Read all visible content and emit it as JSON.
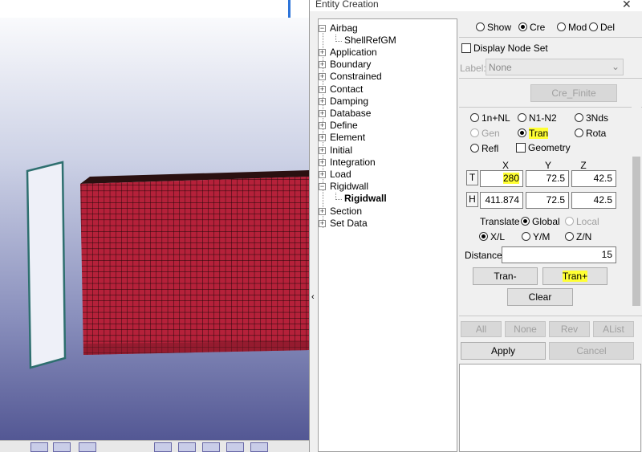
{
  "dialog": {
    "title": "Entity Creation",
    "close": "✕",
    "collapse_arrow": "‹"
  },
  "tree": {
    "items": [
      {
        "label": "Airbag",
        "expanded": true
      },
      {
        "label": "ShellRefGM",
        "child": true
      },
      {
        "label": "Application"
      },
      {
        "label": "Boundary"
      },
      {
        "label": "Constrained"
      },
      {
        "label": "Contact"
      },
      {
        "label": "Damping"
      },
      {
        "label": "Database"
      },
      {
        "label": "Define"
      },
      {
        "label": "Element"
      },
      {
        "label": "Initial"
      },
      {
        "label": "Integration"
      },
      {
        "label": "Load"
      },
      {
        "label": "Rigidwall",
        "expanded": true
      },
      {
        "label": "Rigidwall",
        "child": true,
        "bold": true
      },
      {
        "label": "Section"
      },
      {
        "label": "Set Data"
      }
    ]
  },
  "mode": {
    "show": "Show",
    "cre": "Cre",
    "mod": "Mod",
    "del": "Del",
    "selected": "Cre"
  },
  "display_node_set": "Display Node Set",
  "label_row": {
    "label": "Label:",
    "value": "None"
  },
  "cre_finite": "Cre_Finite",
  "methods": {
    "n1nl": "1n+NL",
    "n1n2": "N1-N2",
    "nds3": "3Nds",
    "gen": "Gen",
    "tran": "Tran",
    "rota": "Rota",
    "refl": "Refl",
    "geometry": "Geometry",
    "selected": "Tran"
  },
  "coords": {
    "x_header": "X",
    "y_header": "Y",
    "z_header": "Z",
    "t_label": "T",
    "t_x": "280",
    "t_y": "72.5",
    "t_z": "42.5",
    "h_label": "H",
    "h_x": "411.874",
    "h_y": "72.5",
    "h_z": "42.5"
  },
  "translate": {
    "label": "Translate",
    "global": "Global",
    "local": "Local",
    "selected": "Global"
  },
  "axis": {
    "xl": "X/L",
    "ym": "Y/M",
    "zn": "Z/N",
    "selected": "X/L"
  },
  "distance": {
    "label": "Distance",
    "value": "15"
  },
  "actions": {
    "tran_minus": "Tran-",
    "tran_plus": "Tran+",
    "clear": "Clear"
  },
  "bottom": {
    "all": "All",
    "none": "None",
    "rev": "Rev",
    "alist": "AList",
    "apply": "Apply",
    "cancel": "Cancel"
  },
  "colors": {
    "mesh": "#b5213a",
    "highlight": "#ffff33",
    "wall": "#e6eaf5"
  }
}
